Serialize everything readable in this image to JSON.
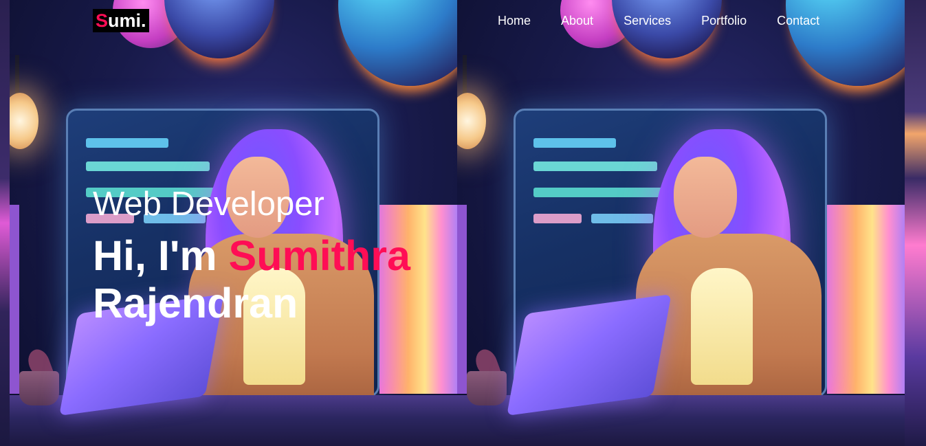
{
  "colors": {
    "accent": "#ff0d55",
    "text": "#ffffff",
    "logo_bg": "#000000"
  },
  "logo": {
    "first_letter": "S",
    "rest": "umi",
    "dot": "."
  },
  "nav": {
    "items": [
      {
        "label": "Home"
      },
      {
        "label": "About"
      },
      {
        "label": "Services"
      },
      {
        "label": "Portfolio"
      },
      {
        "label": "Contact"
      }
    ]
  },
  "hero": {
    "role": "Web Developer",
    "greeting": "Hi, I'm",
    "first_name": "Sumithra",
    "last_name": "Rajendran"
  },
  "background": {
    "image": "illustration-woman-working-on-laptop-neon-room"
  }
}
